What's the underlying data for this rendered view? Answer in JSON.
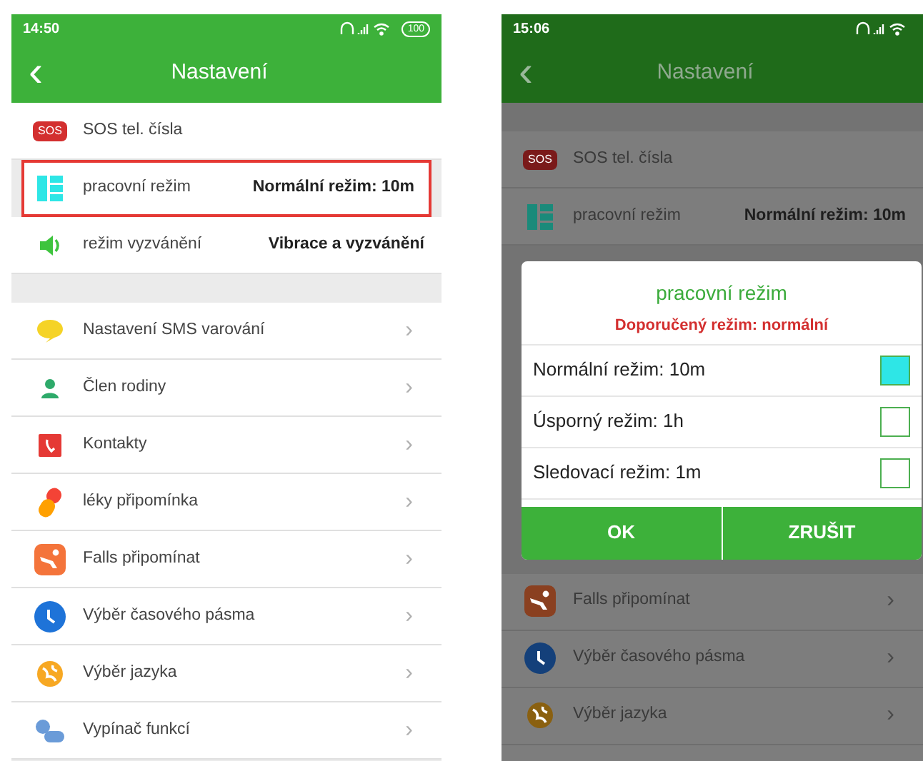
{
  "screens": [
    {
      "dimmed": false,
      "status": {
        "time": "14:50",
        "battery": "100"
      },
      "header": {
        "back": "‹",
        "title": "Nastavení"
      },
      "top_rows": [
        {
          "label": "SOS tel. čísla",
          "icon_text": "SOS",
          "highlighted": false
        },
        {
          "label": "pracovní režim",
          "value": "Normální režim: 10m",
          "highlighted": true
        },
        {
          "label": "režim vyzvánění",
          "value": "Vibrace a vyzvánění",
          "highlighted": false
        }
      ],
      "rows": [
        {
          "label": "Nastavení SMS varování",
          "chevron": "›"
        },
        {
          "label": "Člen rodiny",
          "chevron": "›"
        },
        {
          "label": "Kontakty",
          "chevron": "›"
        },
        {
          "label": "léky připomínka",
          "chevron": "›"
        },
        {
          "label": "Falls připomínat",
          "chevron": "›"
        },
        {
          "label": "Výběr časového pásma",
          "chevron": "›"
        },
        {
          "label": "Výběr jazyka",
          "chevron": "›"
        },
        {
          "label": "Vypínač funkcí",
          "chevron": "›"
        }
      ]
    },
    {
      "dimmed": true,
      "status": {
        "time": "15:06"
      },
      "header": {
        "back": "‹",
        "title": "Nastavení"
      },
      "top_rows": [
        {
          "label": "SOS tel. čísla",
          "icon_text": "SOS",
          "highlighted": false
        },
        {
          "label": "pracovní režim",
          "value": "Normální režim: 10m",
          "highlighted": false
        }
      ],
      "dialog": {
        "title": "pracovní režim",
        "subtitle": "Doporučený režim: normální",
        "options": [
          {
            "label": "Normální režim: 10m",
            "checked": true
          },
          {
            "label": "Úsporný režim: 1h",
            "checked": false
          },
          {
            "label": "Sledovací režim: 1m",
            "checked": false
          }
        ],
        "buttons": [
          "OK",
          "ZRUŠIT"
        ]
      },
      "rows": [
        {
          "label": "Falls připomínat",
          "chevron": "›"
        },
        {
          "label": "Výběr časového pásma",
          "chevron": "›"
        },
        {
          "label": "Výběr jazyka",
          "chevron": "›"
        }
      ]
    }
  ]
}
